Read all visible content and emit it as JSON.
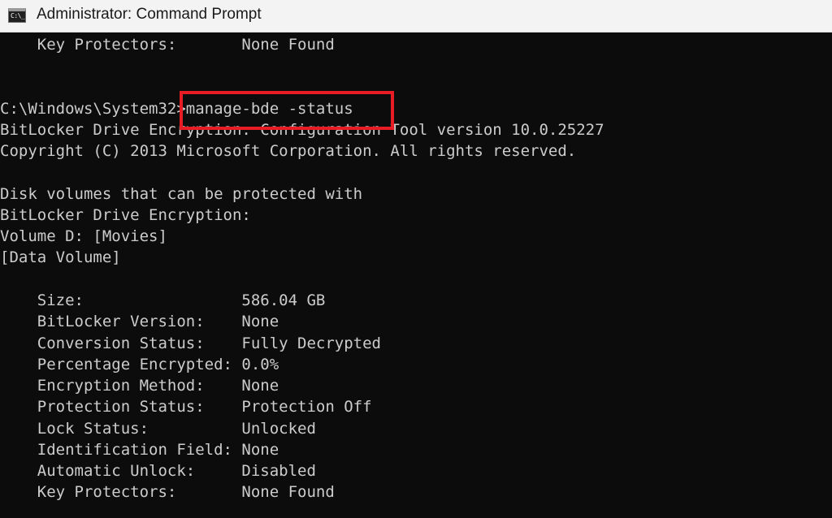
{
  "window": {
    "title": "Administrator: Command Prompt",
    "icon": "cmd-icon",
    "icon_text": "C:\\_"
  },
  "console": {
    "lines": [
      "    Key Protectors:       None Found",
      "",
      "",
      "C:\\Windows\\System32>manage-bde -status",
      "BitLocker Drive Encryption: Configuration Tool version 10.0.25227",
      "Copyright (C) 2013 Microsoft Corporation. All rights reserved.",
      "",
      "Disk volumes that can be protected with",
      "BitLocker Drive Encryption:",
      "Volume D: [Movies]",
      "[Data Volume]",
      "",
      "    Size:                 586.04 GB",
      "    BitLocker Version:    None",
      "    Conversion Status:    Fully Decrypted",
      "    Percentage Encrypted: 0.0%",
      "    Encryption Method:    None",
      "    Protection Status:    Protection Off",
      "    Lock Status:          Unlocked",
      "    Identification Field: None",
      "    Automatic Unlock:     Disabled",
      "    Key Protectors:       None Found"
    ],
    "highlighted_command": "manage-bde -status",
    "highlight_color": "#e81c24",
    "text_color": "#cccccc",
    "background_color": "#0c0c0c"
  }
}
